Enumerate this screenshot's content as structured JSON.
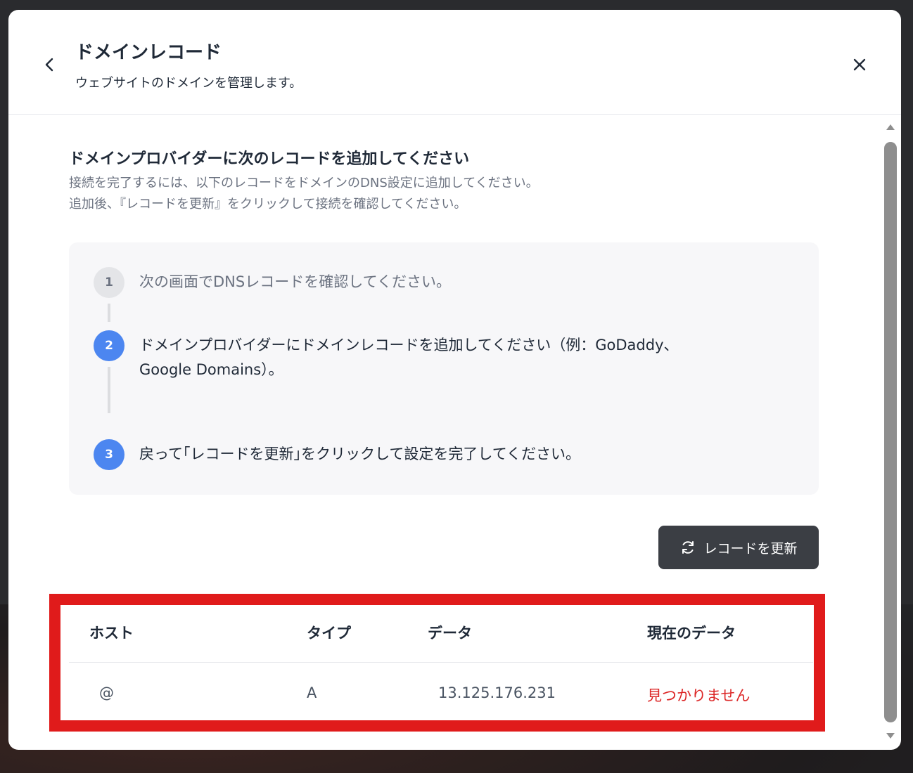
{
  "header": {
    "title": "ドメインレコード",
    "subtitle": "ウェブサイトのドメインを管理します。"
  },
  "section": {
    "title": "ドメインプロバイダーに次のレコードを追加してください",
    "desc_line1": "接続を完了するには、以下のレコードをドメインのDNS設定に追加してください。",
    "desc_line2": "追加後、『レコードを更新』をクリックして接続を確認してください。"
  },
  "steps": [
    {
      "number": "1",
      "text": "次の画面でDNSレコードを確認してください。",
      "state": "pending"
    },
    {
      "number": "2",
      "text_line1": "ドメインプロバイダーにドメインレコードを追加してください（例：GoDaddy、",
      "text_line2": "Google Domains）。",
      "state": "active"
    },
    {
      "number": "3",
      "text": "戻って｢レコードを更新｣をクリックして設定を完了してください。",
      "state": "active"
    }
  ],
  "refresh_button": {
    "label": "レコードを更新",
    "icon": "refresh-icon"
  },
  "records_table": {
    "columns": [
      "ホスト",
      "タイプ",
      "データ",
      "現在のデータ"
    ],
    "rows": [
      {
        "host": "@",
        "type": "A",
        "data": "13.125.176.231",
        "current": "見つかりません"
      }
    ]
  },
  "colors": {
    "accent": "#4c86f0",
    "error": "#dc2626",
    "highlight_border": "#e01b1b",
    "button_dark": "#3b3e44"
  }
}
